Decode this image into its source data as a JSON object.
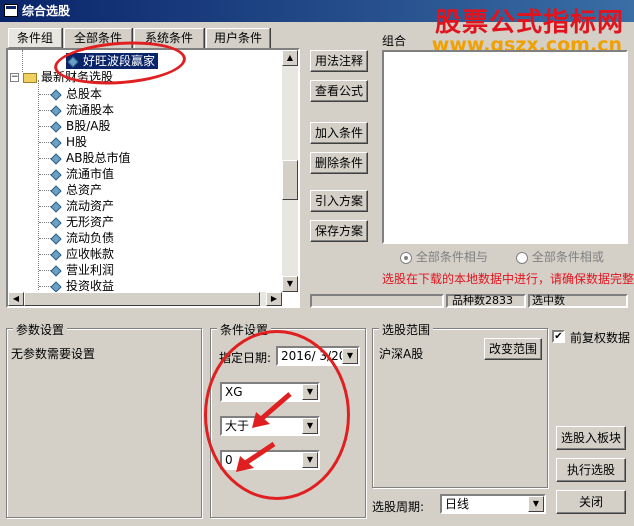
{
  "window": {
    "title": "综合选股"
  },
  "watermark": {
    "line1": "股票公式指标网",
    "line2": "www.gszx.com.cn"
  },
  "tabs": [
    {
      "label": "条件组"
    },
    {
      "label": "全部条件"
    },
    {
      "label": "系统条件"
    },
    {
      "label": "用户条件"
    }
  ],
  "tree": {
    "selected_item": "好旺波段赢家",
    "folder_label": "最新财务选股",
    "items": [
      "总股本",
      "流通股本",
      "B股/A股",
      "H股",
      "AB股总市值",
      "流通市值",
      "总资产",
      "流动资产",
      "无形资产",
      "流动负债",
      "应收帐款",
      "营业利润",
      "投资收益"
    ]
  },
  "side_buttons": {
    "usage_note": "用法注释",
    "view_formula": "查看公式",
    "add_condition": "加入条件",
    "delete_condition": "删除条件",
    "import_plan": "引入方案",
    "save_plan": "保存方案"
  },
  "combo_panel": {
    "label": "组合"
  },
  "logic": {
    "and_label": "全部条件相与",
    "or_label": "全部条件相或"
  },
  "warning_text": "选股在下载的本地数据中进行，请确保数据完整",
  "status": {
    "stock_count_label": "品种数",
    "stock_count": "2833",
    "selected_label": "选中数",
    "selected_value": ""
  },
  "params": {
    "title": "参数设置",
    "text": "无参数需要设置"
  },
  "condition": {
    "title": "条件设置",
    "date_label": "指定日期:",
    "date_value": "2016/ 3/20",
    "field": "XG",
    "operator": "大于",
    "value": "0"
  },
  "range": {
    "title": "选股范围",
    "value": "沪深A股",
    "change_button": "改变范围"
  },
  "period": {
    "label": "选股周期:",
    "value": "日线"
  },
  "options": {
    "pre_adjust_label": "前复权数据",
    "pre_adjust_checked": "✔"
  },
  "actions": {
    "to_block": "选股入板块",
    "run": "执行选股",
    "close": "关闭"
  },
  "colors": {
    "title_start": "#0a246a",
    "title_end": "#3a6ea5",
    "warning": "#e1141e",
    "annotation": "#e02020"
  }
}
